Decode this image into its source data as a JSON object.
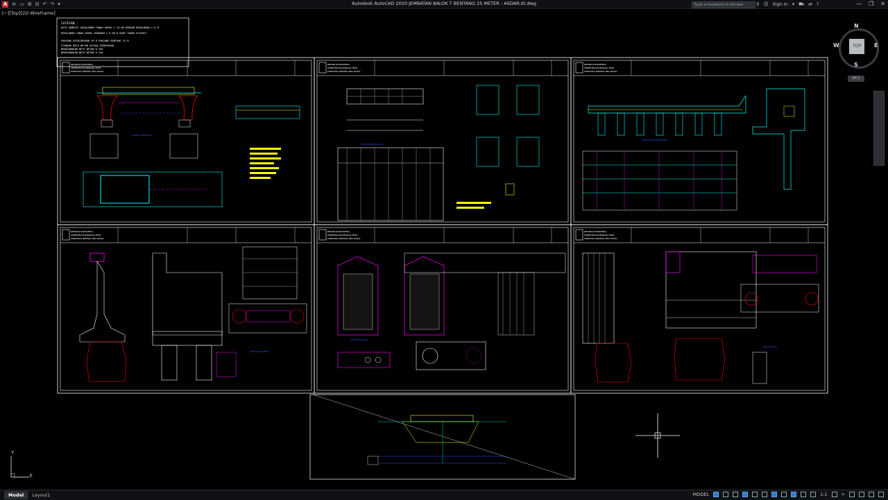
{
  "app": {
    "title": "Autodesk AutoCAD 2020   JEMBATAN BALOK T BENTANG 25 METER - ASDAR.ID.dwg",
    "logo": "A",
    "qat_items": [
      "≡",
      "▭",
      "▾",
      "⊞",
      "⊟",
      "↶",
      "↷",
      "▾"
    ],
    "search_placeholder": "Type a keyword or phrase",
    "sign_in": "Sign In",
    "window_buttons": [
      "—",
      "❐",
      "✕"
    ]
  },
  "viewport": {
    "label": "[−][Top][2D Wireframe]",
    "viewcube": {
      "top": "TOP",
      "n": "N",
      "s": "S",
      "e": "E",
      "w": "W",
      "wcs": "WCS"
    },
    "ucs": {
      "x": "X",
      "y": "Y"
    }
  },
  "notes": {
    "heading": "CATATAN :",
    "lines": [
      "DATA KONDISI KEDALAMAN TANAH KERAS ± 10.00 DENGAN KEDALAMAN ± 8 M",
      "KEDALAMAN TANAH KERAS DIBAWAH  ± 0.00 M DARI TANAH ELEVASI",
      "PANJANG KESELURUHAN 26 M PANJANG BENTANG 25 M",
      "STANDAR MUTU BETON SESUAI KEBUTUHAN",
      "MENGGUNAKAN MUTU BETON K-350",
      "MENGGUNAKAN MUTU BETON K-250"
    ]
  },
  "sheets": [
    {
      "org1": "REPUBLIK INDONESIA",
      "org2": "KEMENTERIAN PEKERJAAN UMUM",
      "org3": "DIREKTORAT JENDERAL BINA MARGA",
      "caption": "TAMPAK JEMBATAN"
    },
    {
      "org1": "REPUBLIK INDONESIA",
      "org2": "KEMENTERIAN PEKERJAAN UMUM",
      "org3": "DIREKTORAT JENDERAL BINA MARGA",
      "caption": "DETAIL PENULANGAN"
    },
    {
      "org1": "REPUBLIK INDONESIA",
      "org2": "KEMENTERIAN PEKERJAAN UMUM",
      "org3": "DIREKTORAT JENDERAL BINA MARGA",
      "caption": "POTONGAN MEMANJANG"
    },
    {
      "org1": "REPUBLIK INDONESIA",
      "org2": "KEMENTERIAN PEKERJAAN UMUM",
      "org3": "DIREKTORAT JENDERAL BINA MARGA",
      "caption": "DETAIL ABUTMENT"
    },
    {
      "org1": "REPUBLIK INDONESIA",
      "org2": "KEMENTERIAN PEKERJAAN UMUM",
      "org3": "DIREKTORAT JENDERAL BINA MARGA",
      "caption": "DETAIL PONDASI"
    },
    {
      "org1": "REPUBLIK INDONESIA",
      "org2": "KEMENTERIAN PEKERJAAN UMUM",
      "org3": "DIREKTORAT JENDERAL BINA MARGA",
      "caption": "DETAIL PILAR"
    }
  ],
  "status": {
    "tabs": [
      "Model",
      "Layout1"
    ],
    "model_label": "MODEL",
    "scale": "1:1",
    "plus": "+"
  },
  "colors": {
    "background": "#000000",
    "sheet_border": "#ffffff",
    "cyan": "#00ffff",
    "yellow": "#ffff00",
    "magenta": "#ff00ff",
    "red": "#ff0000",
    "blue": "#3355ff"
  }
}
